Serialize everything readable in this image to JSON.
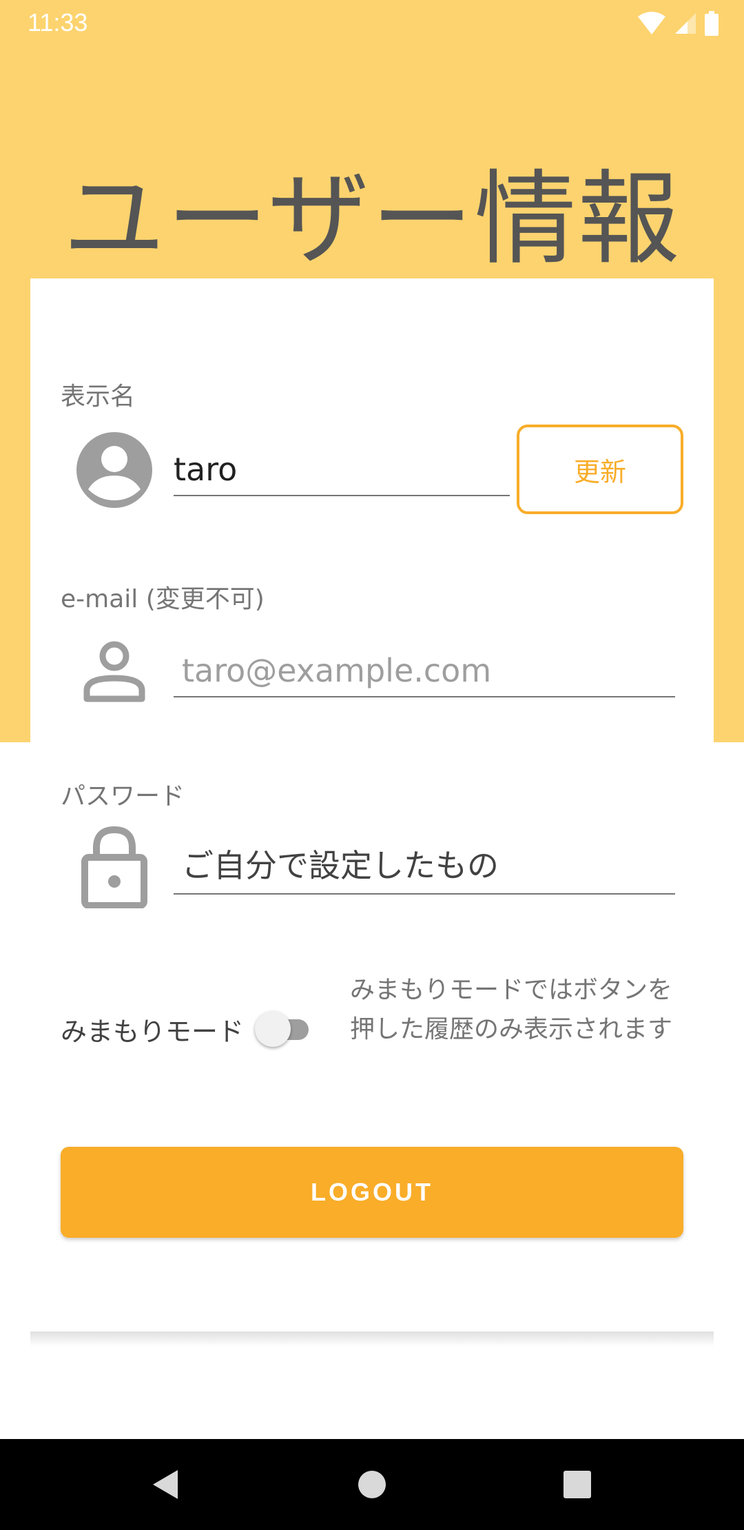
{
  "status_bar": {
    "time": "11:33"
  },
  "page": {
    "title": "ユーザー情報"
  },
  "display_name": {
    "label": "表示名",
    "value": "taro",
    "update_label": "更新"
  },
  "email": {
    "label": "e-mail (変更不可)",
    "placeholder": "taro@example.com"
  },
  "password": {
    "label": "パスワード",
    "value": "ご自分で設定したもの"
  },
  "mimamori": {
    "label": "みまもりモード",
    "enabled": false,
    "description": "みまもりモードではボタンを押した履歴のみ表示されます"
  },
  "logout": {
    "label": "LOGOUT"
  },
  "colors": {
    "header_background": "#FCD36E",
    "accent": "#F9AD29",
    "title_text": "#555555"
  },
  "icons": {
    "avatar": "account-circle-icon",
    "email": "person-outline-icon",
    "password": "lock-icon",
    "nav_back": "back-triangle-icon",
    "nav_home": "home-circle-icon",
    "nav_recents": "recents-square-icon"
  }
}
